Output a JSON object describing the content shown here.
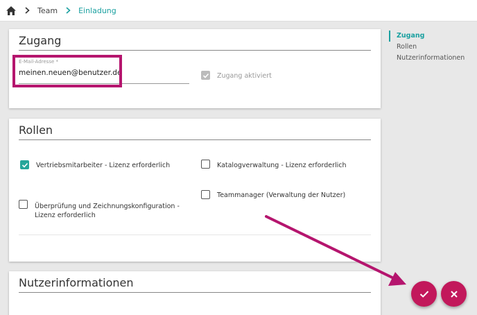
{
  "breadcrumb": {
    "icon": "home-icon",
    "items": [
      {
        "label": "Team"
      },
      {
        "label": "Einladung"
      }
    ]
  },
  "access": {
    "title": "Zugang",
    "email": {
      "label": "E-Mail-Adresse *",
      "value": "meinen.neuen@benutzer.de"
    },
    "access_checkbox": {
      "label": "Zugang aktiviert",
      "checked": true,
      "disabled": true
    }
  },
  "roles": {
    "title": "Rollen",
    "items": [
      {
        "label": "Vertriebsmitarbeiter - Lizenz erforderlich",
        "checked": true
      },
      {
        "label": "Katalogverwaltung - Lizenz erforderlich",
        "checked": false
      },
      {
        "label": "Teammanager (Verwaltung der Nutzer)",
        "checked": false
      },
      {
        "label": "Überprüfung und Zeichnungskonfiguration - Lizenz erforderlich",
        "checked": false
      }
    ]
  },
  "userinfo": {
    "title": "Nutzerinformationen"
  },
  "toc": {
    "items": [
      {
        "label": "Zugang",
        "active": true
      },
      {
        "label": "Rollen",
        "active": false
      },
      {
        "label": "Nutzerinformationen",
        "active": false
      }
    ]
  },
  "actions": {
    "confirm_icon": "check-icon",
    "cancel_icon": "close-icon"
  },
  "colors": {
    "accent": "#1aa0a0",
    "checkbox": "#26a69a",
    "highlight": "#b5156e",
    "fab": "#c2185b"
  }
}
